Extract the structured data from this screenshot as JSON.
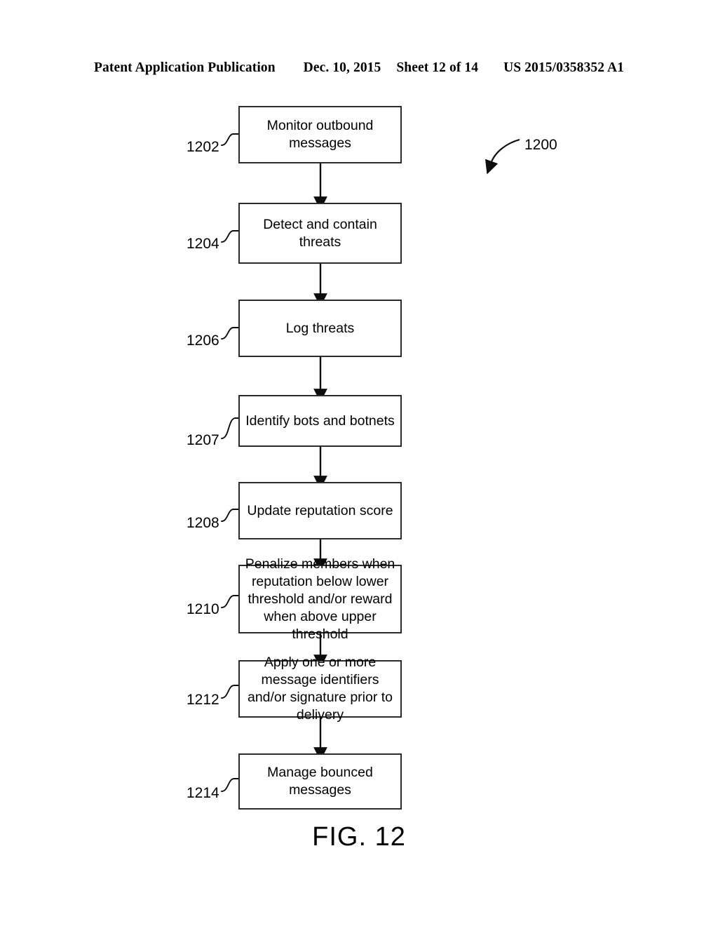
{
  "header": {
    "publication": "Patent Application Publication",
    "date": "Dec. 10, 2015",
    "sheet": "Sheet 12 of 14",
    "doc_number": "US 2015/0358352 A1"
  },
  "figure": {
    "caption": "FIG. 12",
    "diagram_label": "1200"
  },
  "flow": {
    "steps": [
      {
        "ref": "1202",
        "text": "Monitor outbound messages"
      },
      {
        "ref": "1204",
        "text": "Detect and contain threats"
      },
      {
        "ref": "1206",
        "text": "Log threats"
      },
      {
        "ref": "1207",
        "text": "Identify bots and botnets"
      },
      {
        "ref": "1208",
        "text": "Update reputation score"
      },
      {
        "ref": "1210",
        "text": "Penalize members when reputation below lower threshold and/or reward when above upper threshold"
      },
      {
        "ref": "1212",
        "text": "Apply one or more message identifiers and/or signature prior to delivery"
      },
      {
        "ref": "1214",
        "text": "Manage bounced messages"
      }
    ]
  },
  "colors": {
    "ink": "#000000",
    "box_border": "#2b2b2b",
    "paper": "#ffffff"
  }
}
